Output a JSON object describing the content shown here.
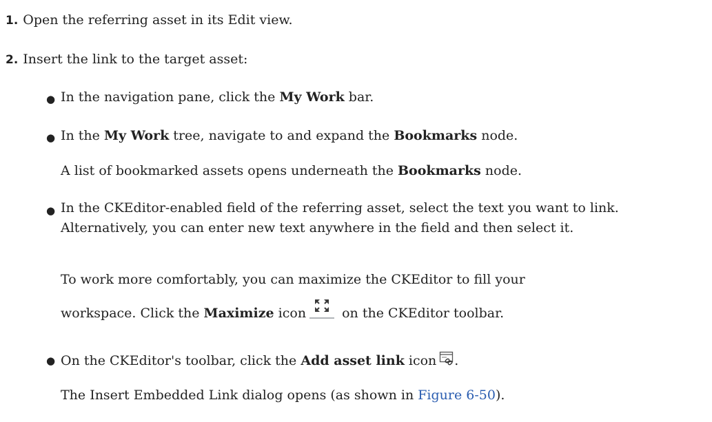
{
  "steps": [
    {
      "number": "1.",
      "text": "Open the referring asset in its Edit view."
    },
    {
      "number": "2.",
      "text": "Insert the link to the target asset:"
    }
  ],
  "bullets": {
    "b1": {
      "pre": "In the navigation pane, click the ",
      "bold": "My Work",
      "post": " bar."
    },
    "b2": {
      "pre": "In the ",
      "bold1": "My Work",
      "mid": " tree, navigate to and expand the ",
      "bold2": "Bookmarks",
      "post": " node."
    },
    "b2_note": {
      "pre": "A list of bookmarked assets opens underneath the ",
      "bold": "Bookmarks",
      "post": " node."
    },
    "b3": "In the CKEditor-enabled field of the referring asset, select the text you want to link. Alternatively, you can enter new text anywhere in the field and then select it.",
    "b3_note1": "To work more comfortably, you can maximize the CKEditor to fill your",
    "b3_note2": {
      "pre": "workspace. Click the ",
      "bold": "Maximize",
      "mid": " icon",
      "post": " on the CKEditor toolbar.",
      "icon": "maximize-icon"
    },
    "b4": {
      "pre": "On the CKEditor's toolbar, click the ",
      "bold": "Add asset link",
      "post": " icon",
      "end": ".",
      "icon": "add-asset-link-icon"
    },
    "b4_note": {
      "pre": "The Insert Embedded Link dialog opens (as shown in ",
      "link": "Figure 6-50",
      "post": ")."
    }
  },
  "colors": {
    "link": "#2a5db0",
    "text": "#222222"
  }
}
